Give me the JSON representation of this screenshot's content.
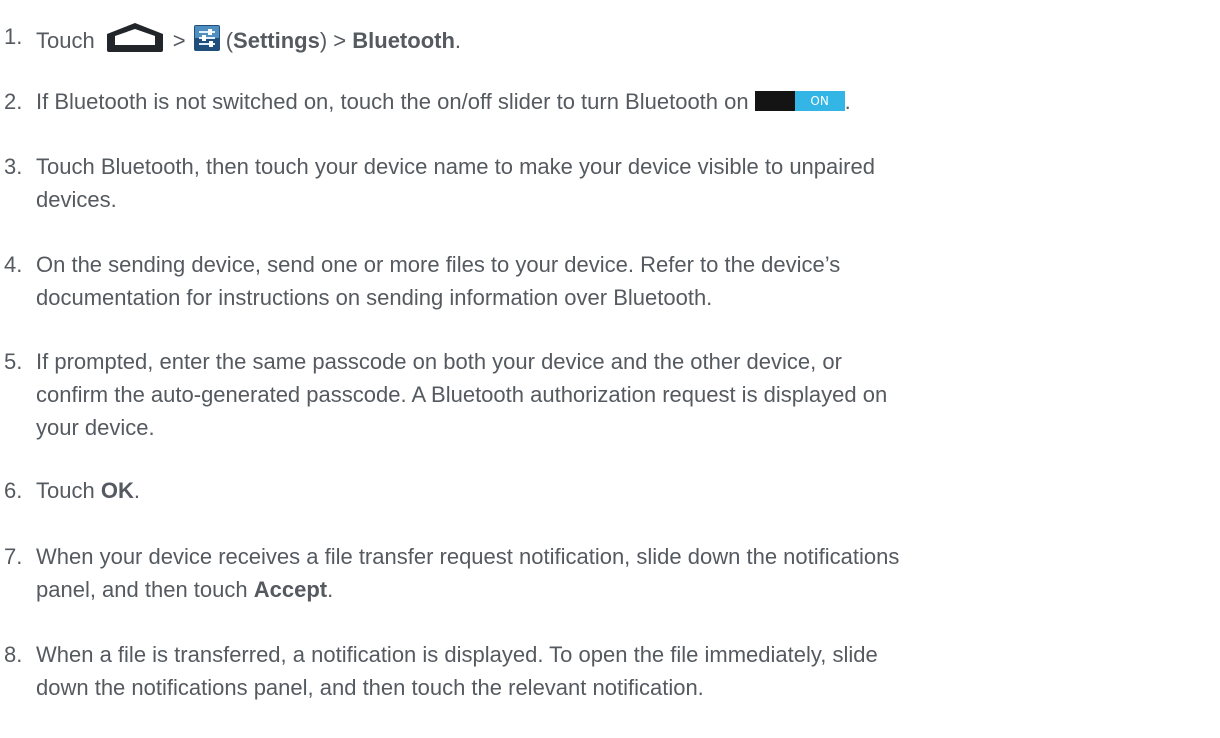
{
  "steps": [
    {
      "number": "1.",
      "parts": {
        "a": "Touch",
        "b": ">",
        "c": "(",
        "d": "Settings",
        "e": ") >",
        "f": "Bluetooth",
        "g": "."
      },
      "icons": [
        "home-icon",
        "settings-icon"
      ]
    },
    {
      "number": "2.",
      "text": "If Bluetooth is not switched on, touch the on/off slider to turn Bluetooth on",
      "toggle_label": "ON",
      "end": ".",
      "toggle_colors": {
        "track": "#141414",
        "knob": "#33b5e5"
      }
    },
    {
      "number": "3.",
      "line1": "Touch Bluetooth, then touch your device name to make your device visible to unpaired",
      "line2": "devices."
    },
    {
      "number": "4.",
      "line1": "On the sending device, send one or more files to your device. Refer to the device’s",
      "line2": "documentation for instructions on sending information over Bluetooth."
    },
    {
      "number": "5.",
      "line1": "If prompted, enter the same passcode on both your device and the other device, or",
      "line2": "confirm the auto-generated passcode. A Bluetooth authorization request is displayed on",
      "line3": "your device."
    },
    {
      "number": "6.",
      "a": "Touch",
      "b": "OK",
      "c": "."
    },
    {
      "number": "7.",
      "line1": "When your device receives a file transfer request notification, slide down the notifications",
      "line2a": "panel, and then touch",
      "line2b": "Accept",
      "line2c": "."
    },
    {
      "number": "8.",
      "line1": "When a file is transferred, a notification is displayed. To open the file immediately, slide",
      "line2": "down the notifications panel, and then touch the relevant notification."
    }
  ],
  "colors": {
    "text": "#555a60"
  }
}
